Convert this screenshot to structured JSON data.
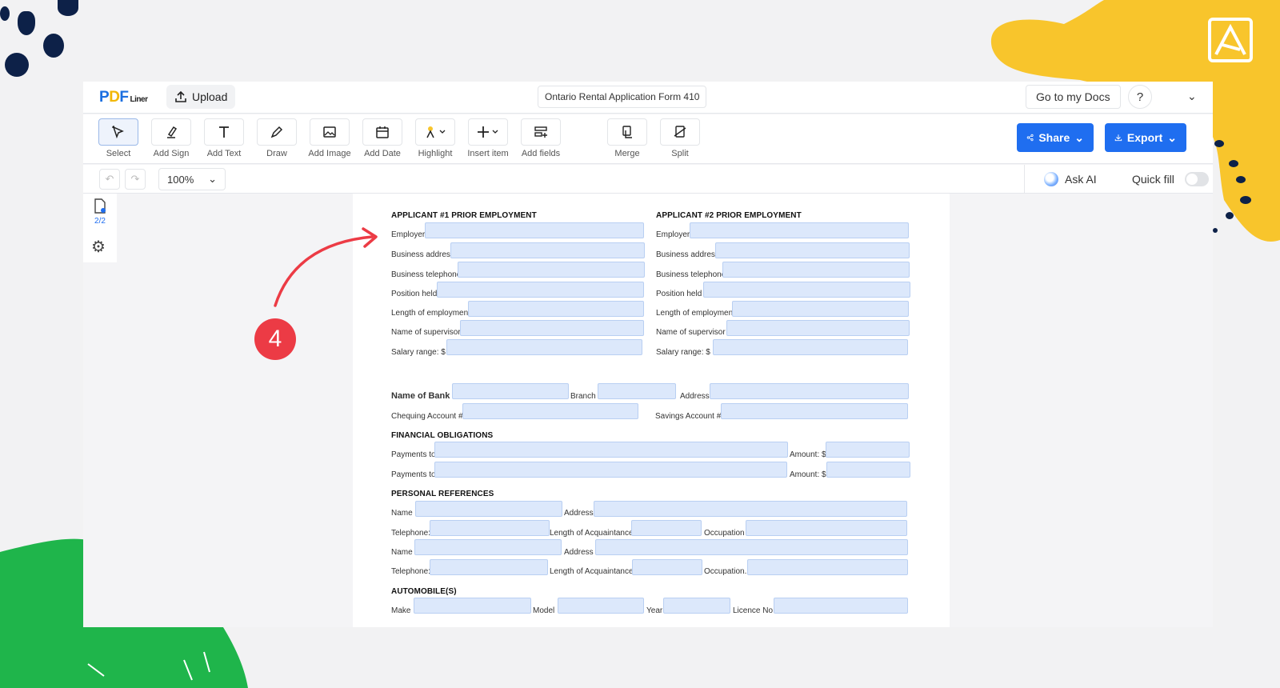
{
  "app": {
    "logo": "PDF",
    "logo_sub": "Liner",
    "upload_label": "Upload",
    "doc_title": "Ontario Rental Application Form 410",
    "go_to_docs": "Go to my Docs",
    "help": "?"
  },
  "toolbar": {
    "tools": [
      {
        "label": "Select",
        "icon": "select-icon"
      },
      {
        "label": "Add Sign",
        "icon": "sign-icon"
      },
      {
        "label": "Add Text",
        "icon": "text-icon"
      },
      {
        "label": "Draw",
        "icon": "pen-icon"
      },
      {
        "label": "Add Image",
        "icon": "image-icon"
      },
      {
        "label": "Add Date",
        "icon": "calendar-icon"
      },
      {
        "label": "Highlight",
        "icon": "highlight-icon"
      },
      {
        "label": "Insert item",
        "icon": "plus-icon"
      },
      {
        "label": "Add fields",
        "icon": "fields-icon"
      },
      {
        "label": "Merge",
        "icon": "merge-icon"
      },
      {
        "label": "Split",
        "icon": "split-icon"
      }
    ],
    "share": "Share",
    "export": "Export"
  },
  "subbar": {
    "zoom": "100%",
    "ask_ai": "Ask AI",
    "quick_fill": "Quick fill"
  },
  "leftnav": {
    "pages": "2/2"
  },
  "form": {
    "applicant1_heading": "APPLICANT #1 PRIOR EMPLOYMENT",
    "applicant2_heading": "APPLICANT #2 PRIOR EMPLOYMENT",
    "a1": [
      "Employer",
      "Business address",
      "Business telephone",
      "Position held",
      "Length of employment",
      "Name of supervisor",
      "Salary range:  $"
    ],
    "a2": [
      "Employer",
      "Business address",
      "Business  telephone",
      "Position  held",
      "Length of employment",
      "Name  of  supervisor",
      "Salary range:  $"
    ],
    "bank": {
      "name": "Name of Bank",
      "branch": "Branch",
      "address": "Address",
      "chequing": "Chequing Account #",
      "savings": "Savings Account #"
    },
    "financial_heading": "FINANCIAL OBLIGATIONS",
    "payments_to": "Payments to",
    "amount": "Amount: $",
    "references_heading": "PERSONAL REFERENCES",
    "ref": {
      "name": "Name",
      "address": "Address",
      "telephone": "Telephone:",
      "length": "Length of Acquaintance",
      "occupation": "Occupation",
      "occupation2": "Occupation."
    },
    "auto_heading": "AUTOMOBILE(S)",
    "auto": {
      "make": "Make",
      "model": "Model",
      "year": "Year",
      "licence": "Licence No"
    }
  },
  "annotation": {
    "step": "4",
    "color": "#ec3b45"
  },
  "colors": {
    "accent": "#1f6ef0",
    "field_fill": "#dce8fb",
    "deco_yellow": "#f8c52c",
    "deco_green": "#1fb54b",
    "deco_navy": "#0d2148"
  }
}
